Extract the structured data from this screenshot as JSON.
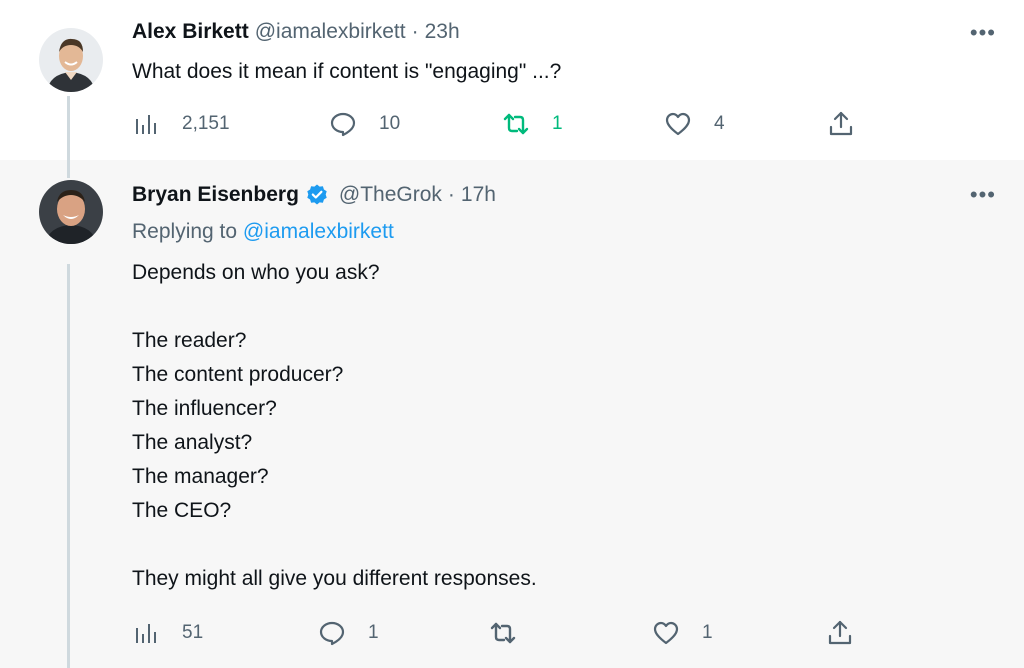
{
  "tweet1": {
    "name": "Alex Birkett",
    "handle": "@iamalexbirkett",
    "separator": "·",
    "time": "23h",
    "more": "•••",
    "text": "What does it mean if content is \"engaging\" ...?",
    "stats": {
      "views": "2,151",
      "replies": "10",
      "retweets": "1",
      "likes": "4"
    },
    "avatar_icon": "person-avatar",
    "retweet_color": "#00ba7c"
  },
  "tweet2": {
    "name": "Bryan Eisenberg",
    "handle": "@TheGrok",
    "separator": "·",
    "time": "17h",
    "more": "•••",
    "verified_icon": "verified-badge-icon",
    "replying_label": "Replying to",
    "replying_handle": "@iamalexbirkett",
    "text": "Depends on who you ask?\n\nThe reader?\nThe content producer?\nThe influencer?\nThe analyst?\nThe manager?\nThe CEO?\n\nThey might all give you different responses.",
    "stats": {
      "views": "51",
      "replies": "1",
      "retweets": "",
      "likes": "1"
    },
    "avatar_icon": "person-avatar"
  },
  "colors": {
    "accent": "#1d9bf0",
    "muted": "#536471",
    "thread_line": "#cfd9de",
    "reply_bg": "#f7f7f7"
  }
}
